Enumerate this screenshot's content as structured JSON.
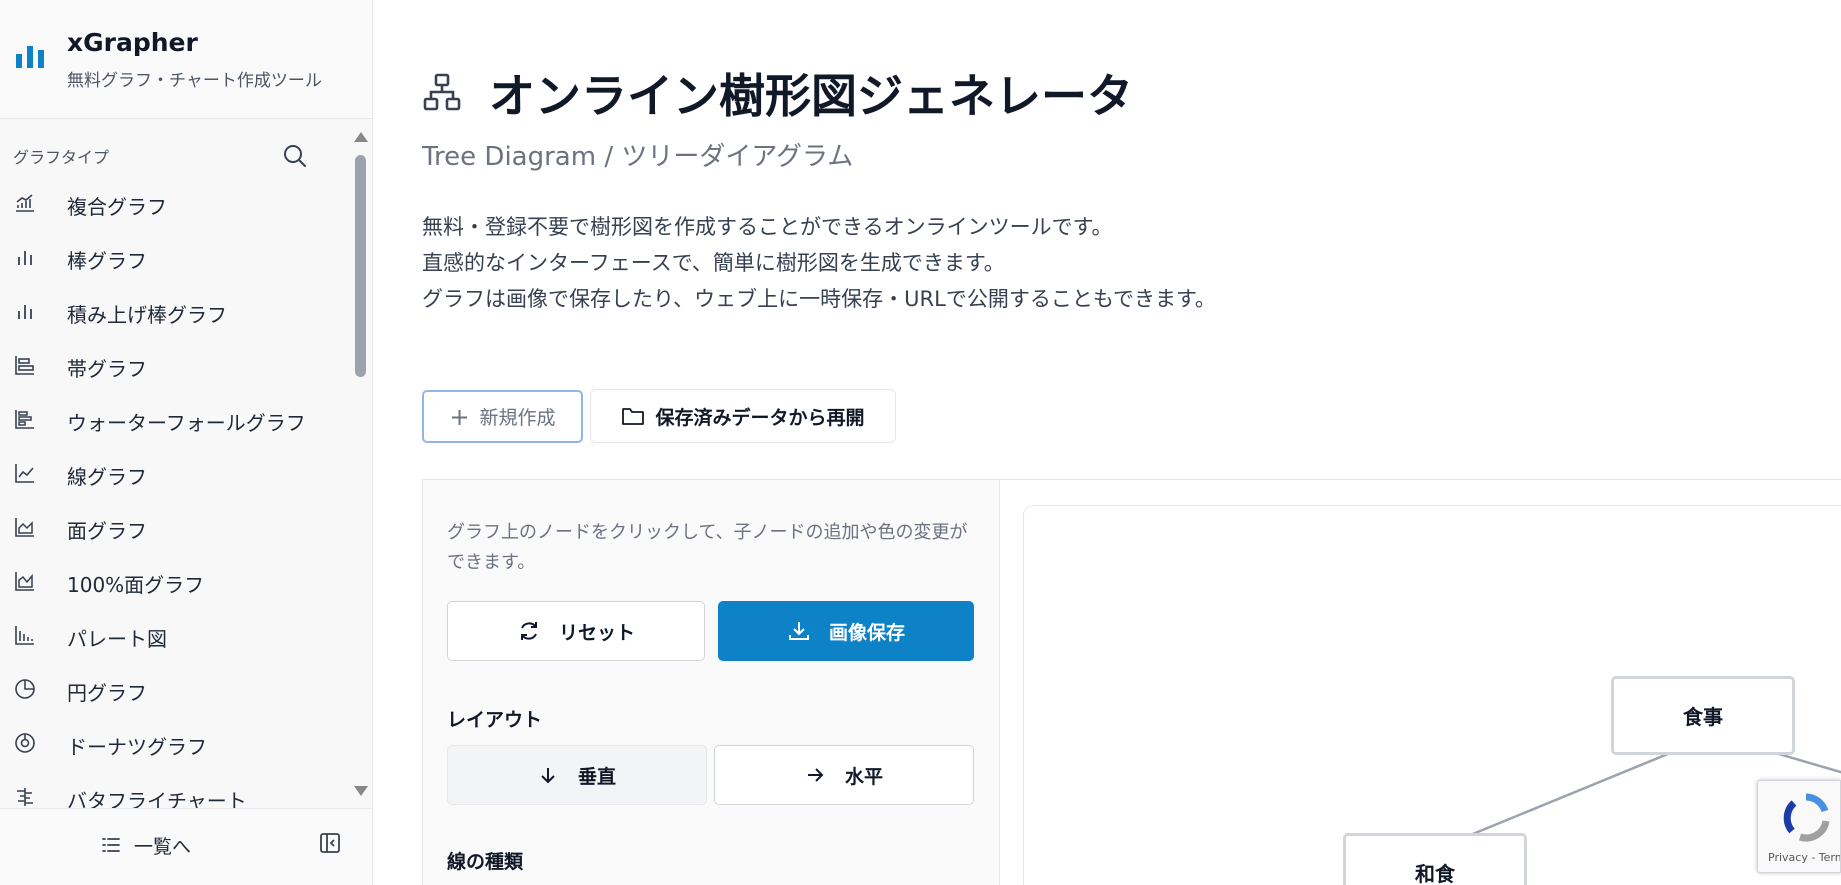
{
  "brand": {
    "title": "xGrapher",
    "subtitle": "無料グラフ・チャート作成ツール",
    "accent": "#0e82c7"
  },
  "sidebar": {
    "heading": "グラフタイプ",
    "items": [
      {
        "label": "複合グラフ",
        "icon": "combo-chart-icon"
      },
      {
        "label": "棒グラフ",
        "icon": "bar-chart-icon"
      },
      {
        "label": "積み上げ棒グラフ",
        "icon": "stacked-bar-icon"
      },
      {
        "label": "帯グラフ",
        "icon": "band-chart-icon"
      },
      {
        "label": "ウォーターフォールグラフ",
        "icon": "waterfall-chart-icon"
      },
      {
        "label": "線グラフ",
        "icon": "line-chart-icon"
      },
      {
        "label": "面グラフ",
        "icon": "area-chart-icon"
      },
      {
        "label": "100%面グラフ",
        "icon": "percent-area-icon"
      },
      {
        "label": "パレート図",
        "icon": "pareto-chart-icon"
      },
      {
        "label": "円グラフ",
        "icon": "pie-chart-icon"
      },
      {
        "label": "ドーナツグラフ",
        "icon": "donut-chart-icon"
      },
      {
        "label": "バタフライチャート",
        "icon": "butterfly-chart-icon"
      }
    ],
    "footer": {
      "list_label": "一覧へ"
    }
  },
  "page": {
    "title": "オンライン樹形図ジェネレータ",
    "subtitle": "Tree Diagram / ツリーダイアグラム",
    "description": [
      "無料・登録不要で樹形図を作成することができるオンラインツールです。",
      "直感的なインターフェースで、簡単に樹形図を生成できます。",
      "グラフは画像で保存したり、ウェブ上に一時保存・URLで公開することもできます。"
    ],
    "new_button": "新規作成",
    "resume_button": "保存済みデータから再開"
  },
  "editor": {
    "hint": "グラフ上のノードをクリックして、子ノードの追加や色の変更ができます。",
    "reset_button": "リセット",
    "save_button": "画像保存",
    "layout_title": "レイアウト",
    "layout_vertical": "垂直",
    "layout_horizontal": "水平",
    "line_type_title": "線の種類"
  },
  "tree": {
    "root": "食事",
    "children": [
      "和食"
    ]
  },
  "recaptcha": {
    "text": "Privacy - Terms"
  }
}
